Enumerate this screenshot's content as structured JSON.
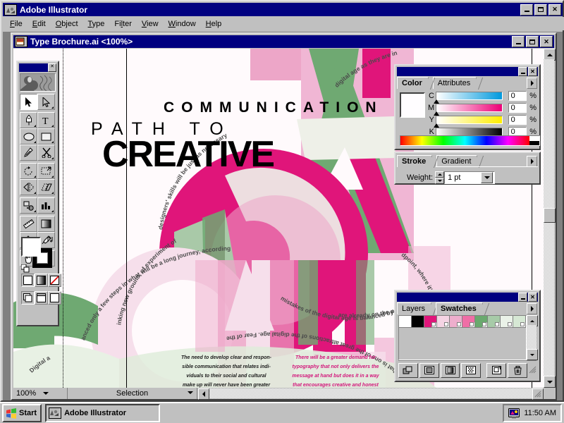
{
  "app": {
    "title": "Adobe Illustrator",
    "icon": "illustrator-app-icon",
    "window_buttons": {
      "minimize": "_",
      "maximize": "□",
      "close": "✕"
    }
  },
  "menubar": {
    "items": [
      {
        "label": "File",
        "accel": "F"
      },
      {
        "label": "Edit",
        "accel": "E"
      },
      {
        "label": "Object",
        "accel": "O"
      },
      {
        "label": "Type",
        "accel": "T"
      },
      {
        "label": "Filter",
        "accel": "l"
      },
      {
        "label": "View",
        "accel": "V"
      },
      {
        "label": "Window",
        "accel": "W"
      },
      {
        "label": "Help",
        "accel": "H"
      }
    ]
  },
  "document": {
    "title": "Type Brochure.ai <100%>",
    "icon": "document-icon",
    "zoom": "100%",
    "tool_status": "Selection"
  },
  "toolbox": {
    "title": "toolbox-palette",
    "tools": [
      {
        "name": "selection-tool",
        "row": 0,
        "col": 0,
        "selected": true,
        "flyout": false
      },
      {
        "name": "direct-selection-tool",
        "row": 0,
        "col": 1,
        "selected": false,
        "flyout": true
      },
      {
        "name": "pen-tool",
        "row": 1,
        "col": 0,
        "selected": false,
        "flyout": true
      },
      {
        "name": "type-tool",
        "row": 1,
        "col": 1,
        "selected": false,
        "flyout": true
      },
      {
        "name": "ellipse-tool",
        "row": 2,
        "col": 0,
        "selected": false,
        "flyout": true
      },
      {
        "name": "rectangle-tool",
        "row": 2,
        "col": 1,
        "selected": false,
        "flyout": true
      },
      {
        "name": "pencil-tool",
        "row": 3,
        "col": 0,
        "selected": false,
        "flyout": false
      },
      {
        "name": "scissors-tool",
        "row": 3,
        "col": 1,
        "selected": false,
        "flyout": true
      },
      {
        "name": "rotate-tool",
        "row": 4,
        "col": 0,
        "selected": false,
        "flyout": true
      },
      {
        "name": "scale-tool",
        "row": 4,
        "col": 1,
        "selected": false,
        "flyout": true
      },
      {
        "name": "reflect-tool",
        "row": 5,
        "col": 0,
        "selected": false,
        "flyout": true
      },
      {
        "name": "shear-tool",
        "row": 5,
        "col": 1,
        "selected": false,
        "flyout": true
      },
      {
        "name": "blend-tool",
        "row": 6,
        "col": 0,
        "selected": false,
        "flyout": true
      },
      {
        "name": "graph-tool",
        "row": 6,
        "col": 1,
        "selected": false,
        "flyout": true
      },
      {
        "name": "measure-tool",
        "row": 7,
        "col": 0,
        "selected": false,
        "flyout": false
      },
      {
        "name": "gradient-tool",
        "row": 7,
        "col": 1,
        "selected": false,
        "flyout": false
      },
      {
        "name": "paint-bucket-tool",
        "row": 8,
        "col": 0,
        "selected": false,
        "flyout": true
      },
      {
        "name": "eyedropper-tool",
        "row": 8,
        "col": 1,
        "selected": false,
        "flyout": false
      },
      {
        "name": "hand-tool",
        "row": 9,
        "col": 0,
        "selected": false,
        "flyout": true
      },
      {
        "name": "zoom-tool",
        "row": 9,
        "col": 1,
        "selected": false,
        "flyout": false
      }
    ],
    "fill_color": "#ffffff",
    "stroke_color": "#000000",
    "paint_styles": [
      {
        "name": "fill-solid-button",
        "selected": true
      },
      {
        "name": "fill-gradient-button",
        "selected": false
      },
      {
        "name": "fill-none-button",
        "selected": false
      }
    ],
    "screen_modes": [
      {
        "name": "standard-screen-mode-button",
        "selected": true
      },
      {
        "name": "full-screen-menubar-button",
        "selected": false
      },
      {
        "name": "full-screen-button",
        "selected": false
      }
    ]
  },
  "color_palette": {
    "tabs": [
      {
        "label": "Color",
        "active": true
      },
      {
        "label": "Attributes",
        "active": false
      }
    ],
    "current_color": "#fffdff",
    "sliders": [
      {
        "label": "C",
        "value": "0",
        "unit": "%",
        "from": "#ffffff",
        "to": "#0099dd",
        "pos": 0
      },
      {
        "label": "M",
        "value": "0",
        "unit": "%",
        "from": "#ffffff",
        "to": "#ee0077",
        "pos": 0
      },
      {
        "label": "Y",
        "value": "0",
        "unit": "%",
        "from": "#ffffff",
        "to": "#ffee00",
        "pos": 0
      },
      {
        "label": "K",
        "value": "0",
        "unit": "%",
        "from": "#ffffff",
        "to": "#000000",
        "pos": 0
      }
    ]
  },
  "stroke_palette": {
    "tabs": [
      {
        "label": "Stroke",
        "active": true
      },
      {
        "label": "Gradient",
        "active": false
      }
    ],
    "weight_label": "Weight:",
    "weight_value": "1 pt"
  },
  "swatches_palette": {
    "tabs": [
      {
        "label": "Layers",
        "active": false
      },
      {
        "label": "Swatches",
        "active": true
      }
    ],
    "swatches": [
      {
        "name": "swatch-white",
        "color": "#ffffff",
        "corner": false
      },
      {
        "name": "swatch-black",
        "color": "#000000",
        "corner": false
      },
      {
        "name": "swatch-magenta",
        "color": "#e00f72",
        "corner": true
      },
      {
        "name": "swatch-pale-pink",
        "color": "#f5d4e4",
        "corner": true
      },
      {
        "name": "swatch-light-pink",
        "color": "#eeaecd",
        "corner": true
      },
      {
        "name": "swatch-pink",
        "color": "#ef6ea6",
        "corner": true
      },
      {
        "name": "swatch-green",
        "color": "#6aa96e",
        "corner": true
      },
      {
        "name": "swatch-light-green",
        "color": "#a7cba8",
        "corner": true
      },
      {
        "name": "swatch-pale-green",
        "color": "#eaf2e8",
        "corner": true
      },
      {
        "name": "swatch-mint",
        "color": "#d6e8d4",
        "corner": true
      }
    ],
    "footer_buttons": [
      {
        "name": "show-all-swatches-button"
      },
      {
        "name": "show-color-swatches-button"
      },
      {
        "name": "show-gradient-swatches-button"
      },
      {
        "name": "show-pattern-swatches-button"
      },
      {
        "name": "new-swatch-button"
      },
      {
        "name": "delete-swatch-button"
      }
    ]
  },
  "artwork": {
    "headline_1": "COMMUNICATION",
    "headline_2": "PATH TO",
    "headline_3": "CREATIVE",
    "big_letters": [
      "A",
      "C",
      "O",
      "M",
      "M",
      "U",
      "N"
    ],
    "path_text_top": "designers' skills will be just as necessary",
    "path_text_top_right": "digital age as they are in",
    "path_text_mid": "mistakes of the digital age is balanced by the",
    "path_text_mid_right": "dpoint, where it's all headed is unknown,",
    "path_text_lower": "are already on the path. T",
    "path_text_left": "inking new ground, of experiment of",
    "path_text_left2": "anced only a few steps in what will be a long journey, according",
    "path_text_bottom": "that is one of the great attractions of the digital age. Fear of the",
    "path_text_bottomleft": "Digital a",
    "body_left": [
      "The need to develop clear and respon-",
      "sible communication that relates indi-",
      "viduals to their social and cultural",
      "make up will never have been greater"
    ],
    "body_right": [
      "There will be a greater demand for",
      "typography that not only delivers the",
      "message at hand but does it in a way",
      "that encourages creative and honest"
    ],
    "colors": {
      "magenta": "#e0157a",
      "pink": "#eda6c8",
      "pale_pink": "#f6dfeb",
      "green": "#6fa972",
      "light_green": "#a9c9a8",
      "pale_green": "#e8f1e4",
      "off_white": "#eef0e8",
      "paper": "#fffafc",
      "body_text_dark": "#1a1a1a",
      "body_text_magenta": "#d2157a"
    }
  },
  "taskbar": {
    "start_label": "Start",
    "start_icon": "windows-flag-icon",
    "tasks": [
      {
        "label": "Adobe Illustrator",
        "icon": "illustrator-app-icon",
        "active": true
      }
    ],
    "tray_icon": "display-settings-icon",
    "clock": "11:50 AM"
  }
}
